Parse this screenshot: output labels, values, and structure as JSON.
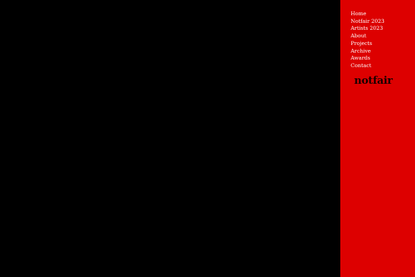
{
  "colors": {
    "background": "#000000",
    "sidebar": "#dd0000",
    "nav_text": "#ffffff",
    "logo_text": "#1a0000"
  },
  "sidebar": {
    "nav_items": [
      {
        "label": "Home"
      },
      {
        "label": "Notfair 2023"
      },
      {
        "label": "Artists 2023"
      },
      {
        "label": "About"
      },
      {
        "label": "Projects"
      },
      {
        "label": "Archive"
      },
      {
        "label": "Awards"
      },
      {
        "label": "Contact"
      }
    ],
    "logo": "notfair"
  }
}
